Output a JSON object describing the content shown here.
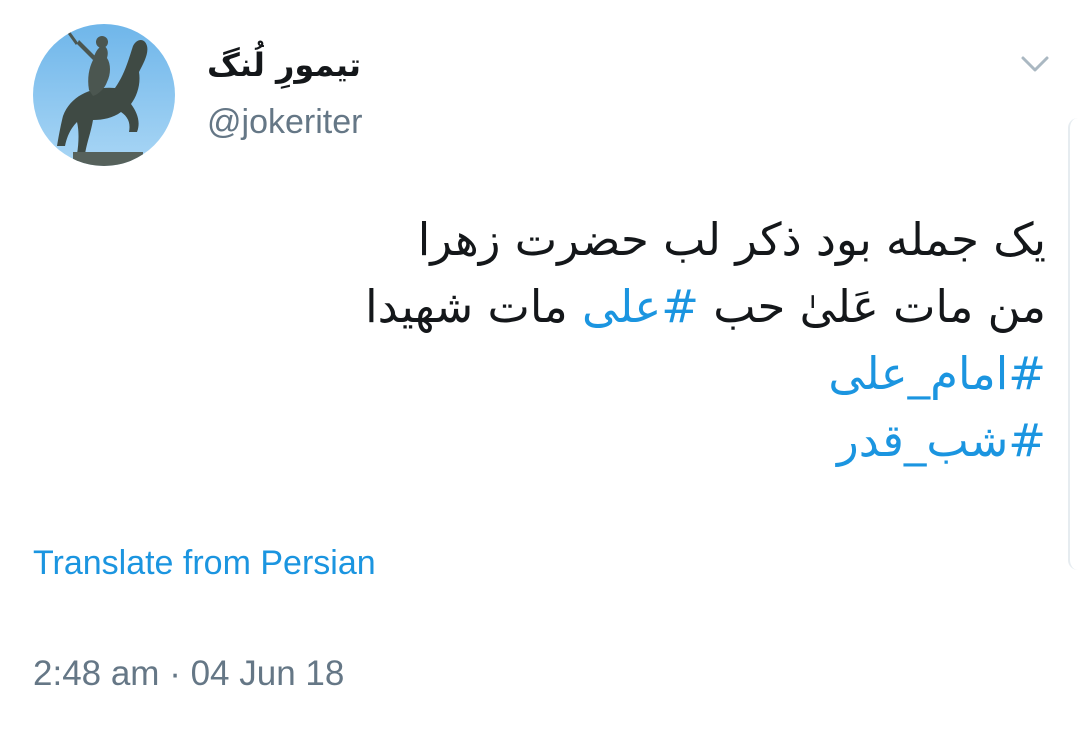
{
  "author": {
    "display_name": "تیمورِ لُنگ",
    "handle": "@jokeriter",
    "avatar": "horseman-statue-avatar"
  },
  "menu": {
    "icon": "chevron-down-icon"
  },
  "tweet": {
    "line1": "یک جمله بود ذکر لب حضرت زهرا",
    "line2_prefix": "من مات عَلیٰ حب ",
    "line2_hashtag": "#علی",
    "line2_suffix": " مات شهیدا",
    "hashtag_imam_ali": "#امام_علی",
    "hashtag_shab_ghadr": "#شب_قدر"
  },
  "translate_label": "Translate from Persian",
  "timestamp": "2:48 am · 04 Jun 18",
  "colors": {
    "link": "#1b95e0",
    "text": "#14171a",
    "muted": "#657786"
  }
}
